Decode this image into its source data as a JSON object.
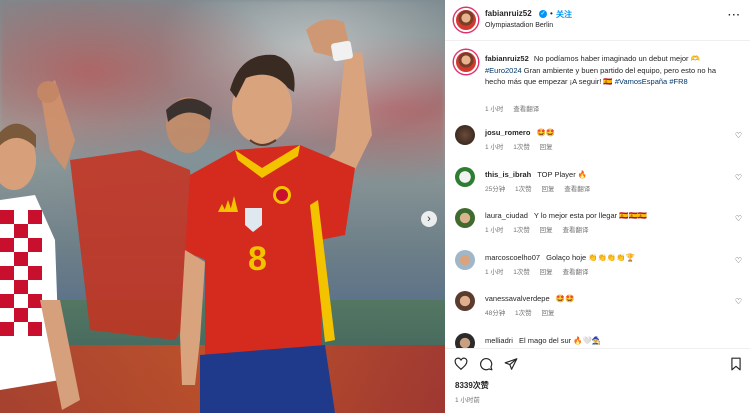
{
  "post": {
    "username": "fabianruiz52",
    "follow_label": "关注",
    "separator": "•",
    "location": "Olympiastadion Berlin"
  },
  "caption": {
    "username": "fabianruiz52",
    "text_before_tag": "No podíamos haber imaginado un debut mejor 🫶",
    "hashtag1": "#Euro2024",
    "text_middle": "Gran ambiente y buen partido del equipo, pero esto no ha hecho más que empezar ¡A seguir! 🇪🇸",
    "hashtag2": "#VamosEspaña",
    "hashtag3": "#FR8",
    "time": "1 小时",
    "translate": "查看翻译"
  },
  "comments": [
    {
      "username": "josu_romero",
      "text": "🤩🤩",
      "time": "1 小时",
      "likes": "1次赞",
      "reply": "回复",
      "translate": ""
    },
    {
      "username": "this_is_ibrah",
      "text": "TOP Player 🔥",
      "time": "25分钟",
      "likes": "1次赞",
      "reply": "回复",
      "translate": "查看翻译"
    },
    {
      "username": "laura_ciudad",
      "text": "Y lo mejor esta por llegar 🇪🇸🇪🇸🇪🇸",
      "time": "1 小时",
      "likes": "1次赞",
      "reply": "回复",
      "translate": "查看翻译"
    },
    {
      "username": "marcoscoelho07",
      "text": "Golaço hoje 👏👏👏👏🏆",
      "time": "1 小时",
      "likes": "1次赞",
      "reply": "回复",
      "translate": "查看翻译"
    },
    {
      "username": "vanessavalverdepe",
      "text": "🤩🤩",
      "time": "48分钟",
      "likes": "1次赞",
      "reply": "回复",
      "translate": ""
    },
    {
      "username": "melliadri",
      "text": "El mago del sur 🔥🤍🧙",
      "time": "",
      "likes": "",
      "reply": "",
      "translate": ""
    }
  ],
  "engagement": {
    "likes": "8339次赞",
    "time": "1 小时前"
  },
  "icons": {
    "more": "more-icon",
    "like": "heart-icon",
    "comment": "comment-icon",
    "share": "share-icon",
    "save": "bookmark-icon",
    "next": "chevron-right-icon"
  },
  "colors": {
    "accent": "#0095f6",
    "hashtag": "#00376b",
    "muted": "#737373",
    "spain_red": "#d52b1e",
    "croatia_red": "#c8102e"
  }
}
